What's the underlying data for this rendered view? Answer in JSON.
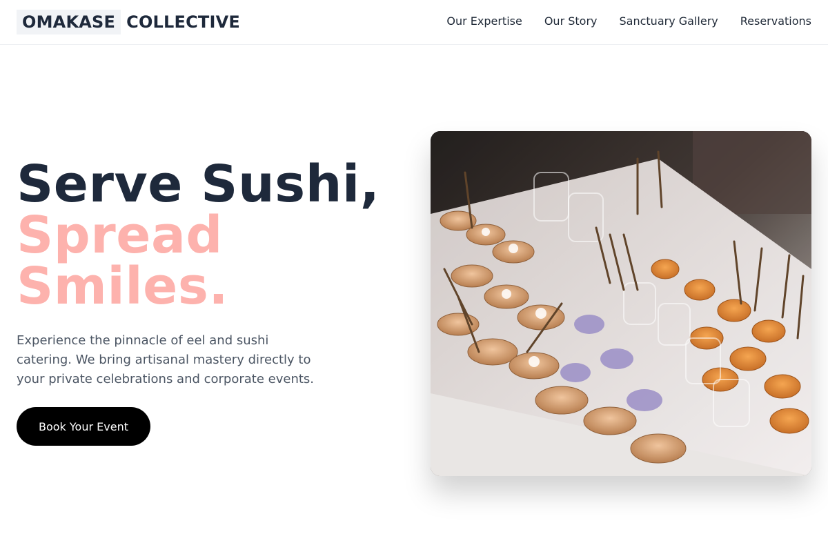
{
  "header": {
    "logo_part1": "OMAKASE",
    "logo_part2": "COLLECTIVE",
    "nav": [
      {
        "label": "Our Expertise"
      },
      {
        "label": "Our Story"
      },
      {
        "label": "Sanctuary Gallery"
      },
      {
        "label": "Reservations"
      }
    ]
  },
  "hero": {
    "title_line1": "Serve Sushi,",
    "title_line2": "Spread",
    "title_line3": "Smiles.",
    "description": "Experience the pinnacle of eel and sushi catering. We bring artisanal mastery directly to your private celebrations and corporate events.",
    "cta_label": "Book Your Event",
    "image_subject": "catering-appetizer-platter-photo"
  },
  "colors": {
    "brand_dark": "#1e293b",
    "accent_pink": "#fdb2ad",
    "button_bg": "#000000"
  }
}
